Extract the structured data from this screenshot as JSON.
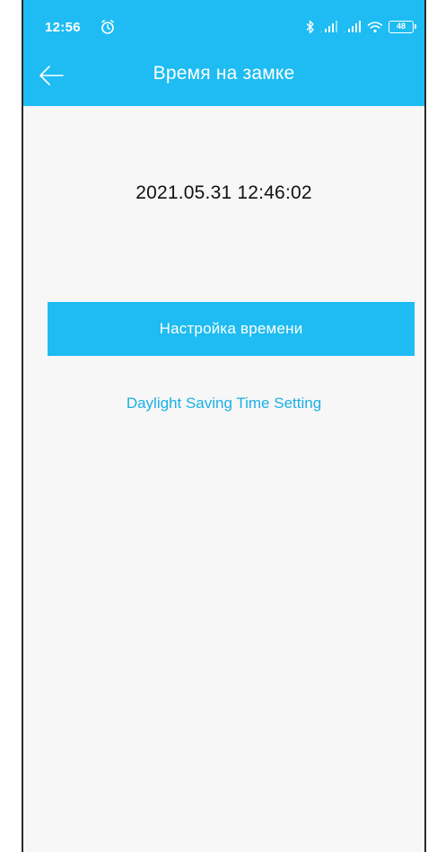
{
  "status_bar": {
    "time": "12:56",
    "battery": "48"
  },
  "header": {
    "title": "Время на замке"
  },
  "main": {
    "datetime": "2021.05.31 12:46:02",
    "set_time_button": "Настройка времени",
    "dst_link": "Daylight Saving Time Setting"
  },
  "colors": {
    "accent": "#1ebcf2",
    "background": "#f7f7f7",
    "link": "#1ab0e6"
  },
  "icons": {
    "back": "arrow-left-icon",
    "alarm": "alarm-clock-icon",
    "bluetooth": "bluetooth-icon",
    "signal": "signal-icon",
    "wifi": "wifi-icon",
    "battery": "battery-icon"
  }
}
